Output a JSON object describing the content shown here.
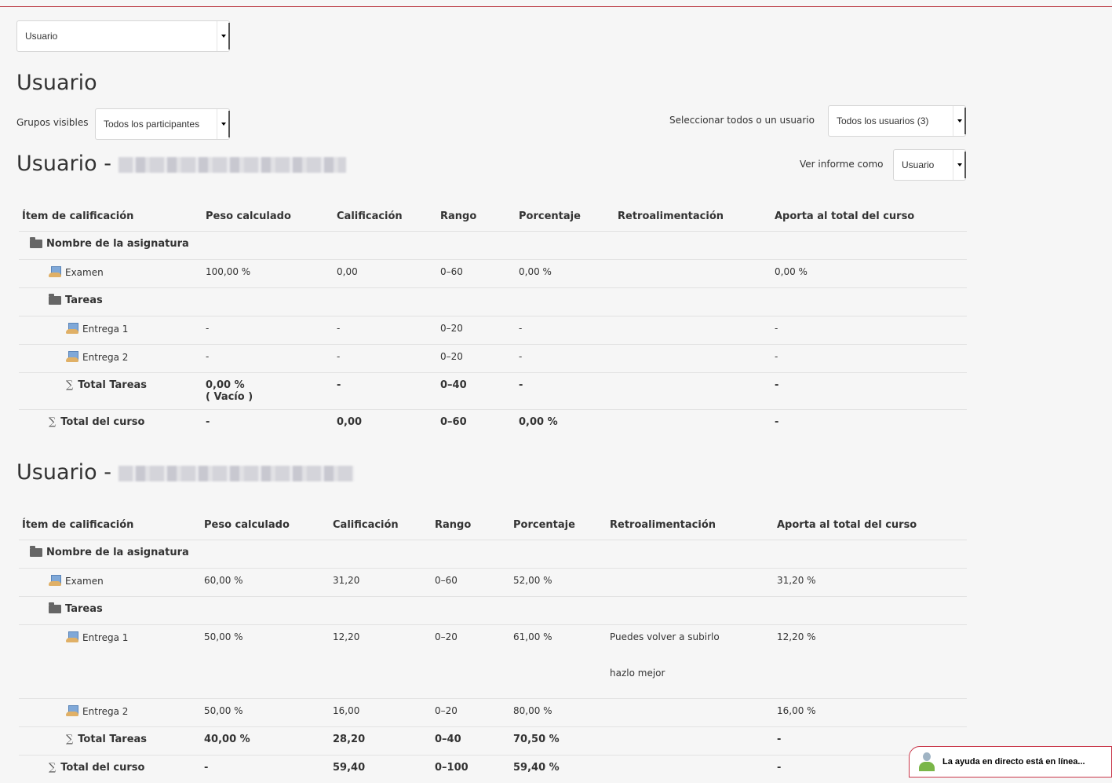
{
  "top_select": "Usuario",
  "page_heading": "Usuario",
  "groups": {
    "label": "Grupos visibles",
    "value": "Todos los participantes"
  },
  "user_select": {
    "label": "Seleccionar todos o un usuario",
    "value": "Todos los usuarios (3)"
  },
  "view_as": {
    "label": "Ver informe como",
    "value": "Usuario"
  },
  "columns": [
    "Ítem de calificación",
    "Peso calculado",
    "Calificación",
    "Rango",
    "Porcentaje",
    "Retroalimentación",
    "Aporta al total del curso"
  ],
  "reports": [
    {
      "title": "Usuario - ",
      "rows": {
        "course": "Nombre de la asignatura",
        "examen": {
          "name": "Examen",
          "peso": "100,00 %",
          "calif": "0,00",
          "rango": "0–60",
          "porc": "0,00 %",
          "retro": "",
          "aporta": "0,00 %"
        },
        "tareas": "Tareas",
        "entrega1": {
          "name": "Entrega 1",
          "peso": "-",
          "calif": "-",
          "rango": "0–20",
          "porc": "-",
          "retro": "",
          "retro2": "",
          "aporta": "-"
        },
        "entrega2": {
          "name": "Entrega 2",
          "peso": "-",
          "calif": "-",
          "rango": "0–20",
          "porc": "-",
          "retro": "",
          "aporta": "-"
        },
        "total_tareas": {
          "name": "Total Tareas",
          "peso": "0,00 %",
          "peso_note": "( Vacío )",
          "calif": "-",
          "rango": "0–40",
          "porc": "-",
          "retro": "",
          "aporta": "-"
        },
        "total_curso": {
          "name": "Total del curso",
          "peso": "-",
          "calif": "0,00",
          "rango": "0–60",
          "porc": "0,00 %",
          "retro": "",
          "aporta": "-"
        }
      }
    },
    {
      "title": "Usuario - ",
      "rows": {
        "course": "Nombre de la asignatura",
        "examen": {
          "name": "Examen",
          "peso": "60,00 %",
          "calif": "31,20",
          "rango": "0–60",
          "porc": "52,00 %",
          "retro": "",
          "aporta": "31,20 %"
        },
        "tareas": "Tareas",
        "entrega1": {
          "name": "Entrega 1",
          "peso": "50,00 %",
          "calif": "12,20",
          "rango": "0–20",
          "porc": "61,00 %",
          "retro": "Puedes volver a subirlo",
          "retro2": "hazlo mejor",
          "aporta": "12,20 %"
        },
        "entrega2": {
          "name": "Entrega 2",
          "peso": "50,00 %",
          "calif": "16,00",
          "rango": "0–20",
          "porc": "80,00 %",
          "retro": "",
          "aporta": "16,00 %"
        },
        "total_tareas": {
          "name": "Total Tareas",
          "peso": "40,00 %",
          "peso_note": "",
          "calif": "28,20",
          "rango": "0–40",
          "porc": "70,50 %",
          "retro": "",
          "aporta": "-"
        },
        "total_curso": {
          "name": "Total del curso",
          "peso": "-",
          "calif": "59,40",
          "rango": "0–100",
          "porc": "59,40 %",
          "retro": "",
          "aporta": "-"
        }
      }
    }
  ],
  "chat": {
    "label": "La ayuda en directo está en línea..."
  },
  "icons": {
    "folder": "folder-icon",
    "assignment": "assignment-icon",
    "sum": "sigma-icon",
    "dropdown": "chevron-down-icon",
    "chat_avatar": "support-avatar-icon"
  },
  "colors": {
    "accent": "#b52a35",
    "background": "#f6f6f6"
  }
}
